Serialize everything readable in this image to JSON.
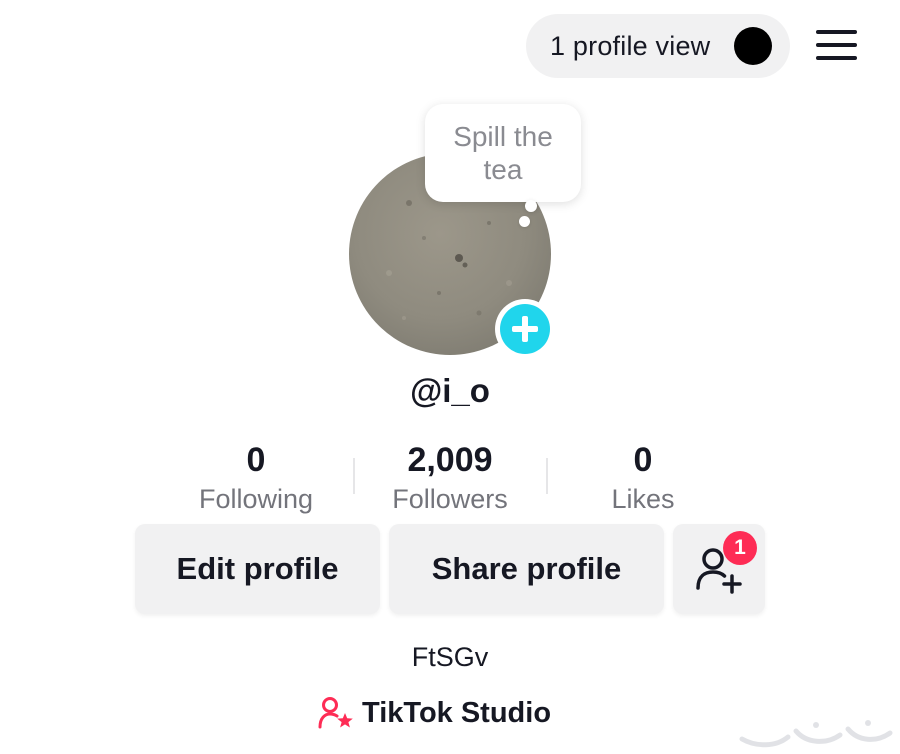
{
  "header": {
    "profile_views_label": "1 profile view"
  },
  "profile": {
    "note_bubble": "Spill the tea",
    "username": "@i_o",
    "bio": "FtSGv"
  },
  "stats": [
    {
      "value": "0",
      "label": "Following"
    },
    {
      "value": "2,009",
      "label": "Followers"
    },
    {
      "value": "0",
      "label": "Likes"
    }
  ],
  "actions": {
    "edit_profile_label": "Edit profile",
    "share_profile_label": "Share profile",
    "add_friends_badge": "1"
  },
  "studio": {
    "label": "TikTok Studio"
  },
  "icons": {
    "menu": "hamburger-menu-icon",
    "add_avatar": "plus-icon",
    "add_friends": "add-user-icon",
    "studio": "user-star-icon"
  },
  "colors": {
    "accent_cyan": "#20d5ec",
    "badge_red": "#fe2c55",
    "studio_pink": "#fe2c55",
    "button_bg": "#f1f1f2",
    "text_primary": "#161823",
    "text_secondary": "#73747b"
  }
}
